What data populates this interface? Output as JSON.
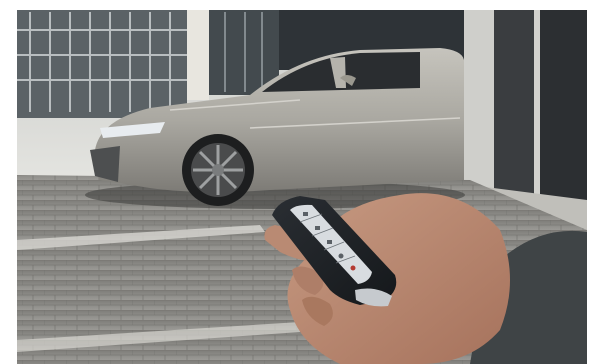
{
  "image": {
    "subject": "",
    "colors": {
      "sky": "#d7d9d8",
      "pavement": "#8c8c89",
      "car_body": "#a9a8a2",
      "pillar": "#3a3d40",
      "skin": "#b98a73",
      "sleeve": "#3f4446",
      "key_fob": "#1f2226",
      "key_buttons": "#d8dce0"
    },
    "icons": [
      "lock-icon",
      "unlock-icon",
      "trunk-icon",
      "panic-icon",
      "remote-start-icon"
    ]
  }
}
